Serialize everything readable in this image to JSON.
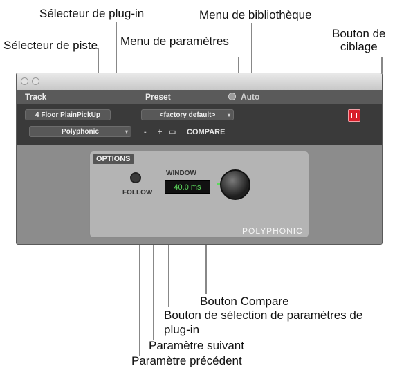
{
  "annotations": {
    "plugin_selector": "Sélecteur de plug-in",
    "library_menu": "Menu de bibliothèque",
    "track_selector": "Sélecteur de piste",
    "settings_menu": "Menu de paramètres",
    "target_button": "Bouton de\nciblage",
    "compare_button": "Bouton Compare",
    "settings_select_line1": "Bouton de sélection de paramètres de",
    "settings_select_line2": "plug-in",
    "next_setting": "Paramètre suivant",
    "previous_setting": "Paramètre précédent"
  },
  "plugin_window": {
    "header": {
      "track_label": "Track",
      "preset_label": "Preset",
      "auto_label": "Auto",
      "track_name": "4 Floor PlainPickUp",
      "plugin_name": "Polyphonic",
      "preset_name": "<factory default>",
      "prev_symbol": "-",
      "next_symbol": "+",
      "compare_label": "COMPARE"
    },
    "body": {
      "options_label": "OPTIONS",
      "follow_label": "FOLLOW",
      "window_label": "WINDOW",
      "window_value": "40.0 ms",
      "brand_label": "POLYPHONIC"
    }
  },
  "colors": {
    "target_button": "#d81e2a",
    "lcd_text": "#5cd95c",
    "header_bg": "#3a3a3a"
  }
}
